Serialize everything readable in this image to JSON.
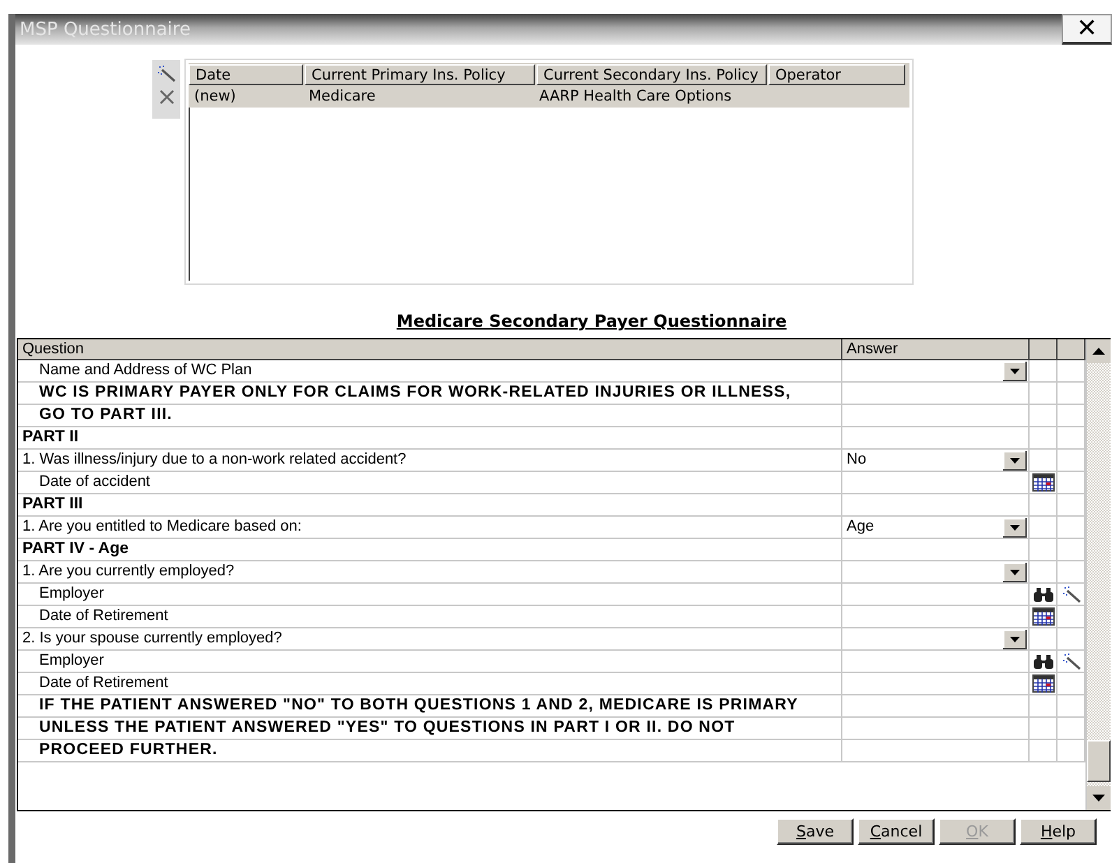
{
  "window": {
    "title": "MSP Questionnaire",
    "close": "✕"
  },
  "history": {
    "tools": [
      {
        "kind": "wand"
      },
      {
        "kind": "delete"
      }
    ],
    "columns": [
      "Date",
      "Current Primary Ins. Policy",
      "Current Secondary Ins. Policy",
      "Operator"
    ],
    "rows": [
      {
        "selected": true,
        "cells": [
          "(new)",
          "Medicare",
          "AARP Health Care Options",
          ""
        ]
      }
    ]
  },
  "heading": "Medicare Secondary Payer Questionnaire",
  "grid": {
    "columns": [
      "Question",
      "Answer"
    ],
    "rows": [
      {
        "kind": "sub",
        "question": "Name and Address of WC Plan",
        "dropdown": true
      },
      {
        "kind": "note",
        "question": "WC IS PRIMARY PAYER ONLY FOR CLAIMS FOR WORK-RELATED INJURIES OR ILLNESS,"
      },
      {
        "kind": "note",
        "question": "GO TO PART III."
      },
      {
        "kind": "section",
        "question": "PART II"
      },
      {
        "kind": "question",
        "question": "1. Was illness/injury due to a non-work related accident?",
        "answer": "No",
        "dropdown": true
      },
      {
        "kind": "sub",
        "question": "Date of accident",
        "tools": [
          {
            "kind": "calendar"
          }
        ]
      },
      {
        "kind": "section",
        "question": "PART III"
      },
      {
        "kind": "question",
        "question": "1. Are you entitled to Medicare based on:",
        "answer": "Age",
        "dropdown": true
      },
      {
        "kind": "section",
        "question": "PART IV - Age"
      },
      {
        "kind": "question",
        "question": "1. Are you currently employed?",
        "dropdown": true
      },
      {
        "kind": "sub",
        "question": "Employer",
        "tools": [
          {
            "kind": "search"
          },
          {
            "kind": "wand"
          }
        ]
      },
      {
        "kind": "sub",
        "question": "Date of Retirement",
        "tools": [
          {
            "kind": "calendar"
          }
        ]
      },
      {
        "kind": "question",
        "question": "2. Is your spouse currently employed?",
        "dropdown": true
      },
      {
        "kind": "sub",
        "question": "Employer",
        "tools": [
          {
            "kind": "search"
          },
          {
            "kind": "wand"
          }
        ]
      },
      {
        "kind": "sub",
        "question": "Date of Retirement",
        "tools": [
          {
            "kind": "calendar"
          }
        ]
      },
      {
        "kind": "note",
        "question": "IF THE PATIENT ANSWERED \"NO\" TO BOTH QUESTIONS 1 AND 2, MEDICARE IS PRIMARY"
      },
      {
        "kind": "note",
        "question": "UNLESS THE PATIENT ANSWERED \"YES\" TO QUESTIONS IN PART I OR II. DO NOT"
      },
      {
        "kind": "note",
        "question": "PROCEED FURTHER."
      }
    ]
  },
  "buttons": [
    {
      "mnemonic": "S",
      "label_rest": "ave",
      "disabled": false
    },
    {
      "mnemonic": "C",
      "label_rest": "ancel",
      "disabled": false
    },
    {
      "mnemonic": "O",
      "label_rest": "K",
      "disabled": true
    },
    {
      "mnemonic": "H",
      "label_rest": "elp",
      "disabled": false
    }
  ]
}
